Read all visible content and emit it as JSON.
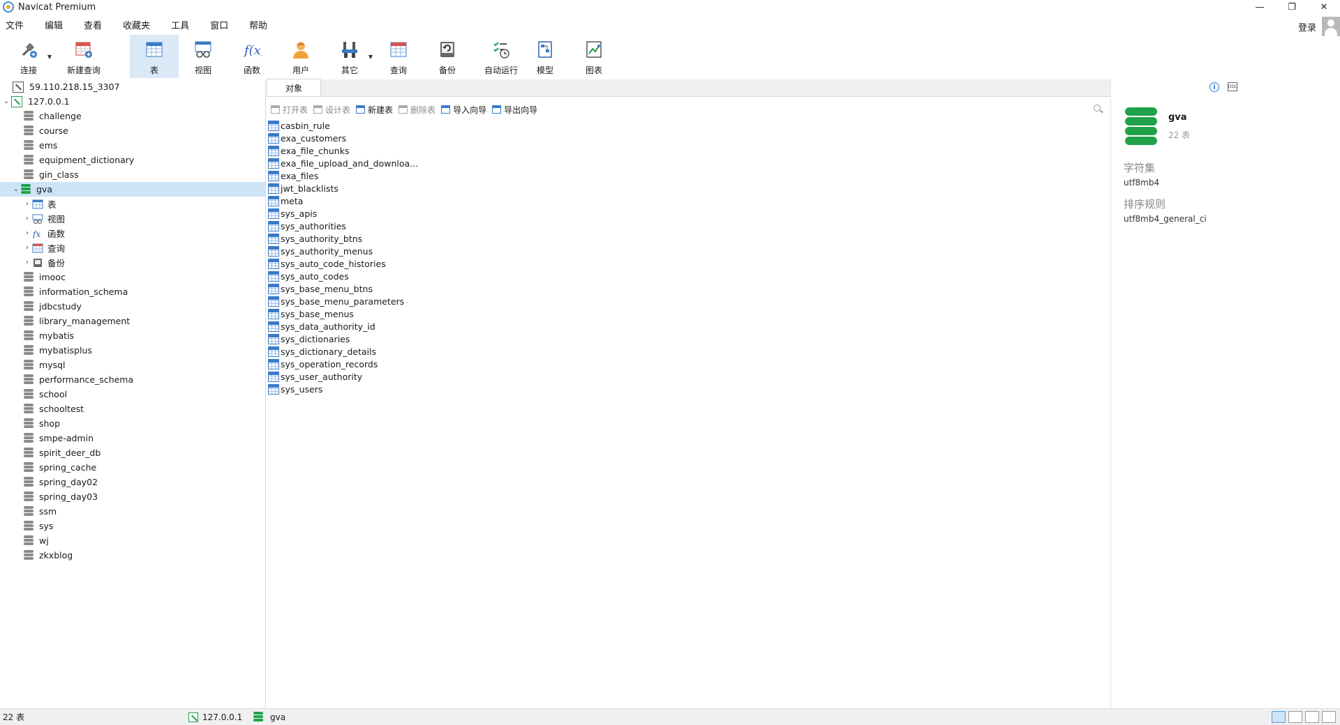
{
  "window": {
    "title": "Navicat Premium",
    "minimize": "—",
    "restore": "❐",
    "close": "✕"
  },
  "menu": [
    "文件",
    "编辑",
    "查看",
    "收藏夹",
    "工具",
    "窗口",
    "帮助"
  ],
  "login": "登录",
  "toolbar": [
    {
      "label": "连接",
      "icon": "plug-icon"
    },
    {
      "label": "新建查询",
      "icon": "new-query-icon"
    },
    {
      "label": "表",
      "icon": "table-icon"
    },
    {
      "label": "视图",
      "icon": "view-icon"
    },
    {
      "label": "函数",
      "icon": "function-icon"
    },
    {
      "label": "用户",
      "icon": "user-icon"
    },
    {
      "label": "其它",
      "icon": "tools-icon"
    },
    {
      "label": "查询",
      "icon": "query-icon"
    },
    {
      "label": "备份",
      "icon": "backup-icon"
    },
    {
      "label": "自动运行",
      "icon": "schedule-icon"
    },
    {
      "label": "模型",
      "icon": "model-icon"
    },
    {
      "label": "图表",
      "icon": "chart-icon"
    }
  ],
  "tree": {
    "connections": [
      {
        "name": "59.110.218.15_3307"
      },
      {
        "name": "127.0.0.1"
      }
    ],
    "databases": [
      "challenge",
      "course",
      "ems",
      "equipment_dictionary",
      "gin_class",
      "gva",
      "imooc",
      "information_schema",
      "jdbcstudy",
      "library_management",
      "mybatis",
      "mybatisplus",
      "mysql",
      "performance_schema",
      "school",
      "schooltest",
      "shop",
      "smpe-admin",
      "spirit_deer_db",
      "spring_cache",
      "spring_day02",
      "spring_day03",
      "ssm",
      "sys",
      "wj",
      "zkxblog"
    ],
    "gva_children": [
      {
        "label": "表",
        "icon": "table-icon"
      },
      {
        "label": "视图",
        "icon": "view-icon"
      },
      {
        "label": "函数",
        "icon": "function-icon"
      },
      {
        "label": "查询",
        "icon": "query-icon"
      },
      {
        "label": "备份",
        "icon": "backup-icon"
      }
    ]
  },
  "tab": {
    "label": "对象"
  },
  "object_toolbar": {
    "open": "打开表",
    "design": "设计表",
    "new": "新建表",
    "delete": "删除表",
    "import": "导入向导",
    "export": "导出向导"
  },
  "tables": [
    "casbin_rule",
    "exa_customers",
    "exa_file_chunks",
    "exa_file_upload_and_downloa...",
    "exa_files",
    "jwt_blacklists",
    "meta",
    "sys_apis",
    "sys_authorities",
    "sys_authority_btns",
    "sys_authority_menus",
    "sys_auto_code_histories",
    "sys_auto_codes",
    "sys_base_menu_btns",
    "sys_base_menu_parameters",
    "sys_base_menus",
    "sys_data_authority_id",
    "sys_dictionaries",
    "sys_dictionary_details",
    "sys_operation_records",
    "sys_user_authority",
    "sys_users"
  ],
  "info": {
    "db_name": "gva",
    "table_count": "22 表",
    "charset_label": "字符集",
    "charset_value": "utf8mb4",
    "collation_label": "排序规则",
    "collation_value": "utf8mb4_general_ci"
  },
  "status": {
    "count": "22 表",
    "connection": "127.0.0.1",
    "database": "gva"
  },
  "colors": {
    "accent": "#2f7fd6",
    "selection": "#cde4f7",
    "db_green": "#1fa24a"
  }
}
